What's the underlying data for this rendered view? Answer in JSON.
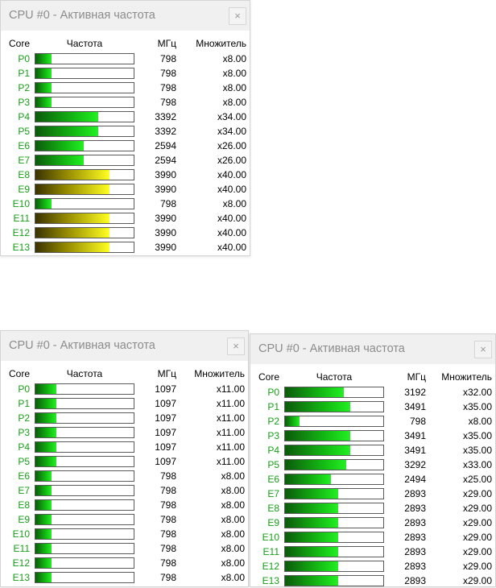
{
  "windows": [
    {
      "title": "CPU #0 - Активная частота",
      "close": "×",
      "headers": {
        "core": "Core",
        "freq": "Частота",
        "mhz": "МГц",
        "mult": "Множитель"
      },
      "rows": [
        {
          "core": "P0",
          "mhz": "798",
          "mult": "x8.00",
          "fill": 0.16,
          "color": "green"
        },
        {
          "core": "P1",
          "mhz": "798",
          "mult": "x8.00",
          "fill": 0.16,
          "color": "green"
        },
        {
          "core": "P2",
          "mhz": "798",
          "mult": "x8.00",
          "fill": 0.16,
          "color": "green"
        },
        {
          "core": "P3",
          "mhz": "798",
          "mult": "x8.00",
          "fill": 0.16,
          "color": "green"
        },
        {
          "core": "P4",
          "mhz": "3392",
          "mult": "x34.00",
          "fill": 0.64,
          "color": "green"
        },
        {
          "core": "P5",
          "mhz": "3392",
          "mult": "x34.00",
          "fill": 0.64,
          "color": "green"
        },
        {
          "core": "E6",
          "mhz": "2594",
          "mult": "x26.00",
          "fill": 0.49,
          "color": "green"
        },
        {
          "core": "E7",
          "mhz": "2594",
          "mult": "x26.00",
          "fill": 0.49,
          "color": "green"
        },
        {
          "core": "E8",
          "mhz": "3990",
          "mult": "x40.00",
          "fill": 0.75,
          "color": "yellow"
        },
        {
          "core": "E9",
          "mhz": "3990",
          "mult": "x40.00",
          "fill": 0.75,
          "color": "yellow"
        },
        {
          "core": "E10",
          "mhz": "798",
          "mult": "x8.00",
          "fill": 0.16,
          "color": "green"
        },
        {
          "core": "E11",
          "mhz": "3990",
          "mult": "x40.00",
          "fill": 0.75,
          "color": "yellow"
        },
        {
          "core": "E12",
          "mhz": "3990",
          "mult": "x40.00",
          "fill": 0.75,
          "color": "yellow"
        },
        {
          "core": "E13",
          "mhz": "3990",
          "mult": "x40.00",
          "fill": 0.75,
          "color": "yellow"
        }
      ]
    },
    {
      "title": "CPU #0 - Активная частота",
      "close": "×",
      "headers": {
        "core": "Core",
        "freq": "Частота",
        "mhz": "МГц",
        "mult": "Множитель"
      },
      "rows": [
        {
          "core": "P0",
          "mhz": "1097",
          "mult": "x11.00",
          "fill": 0.21,
          "color": "green"
        },
        {
          "core": "P1",
          "mhz": "1097",
          "mult": "x11.00",
          "fill": 0.21,
          "color": "green"
        },
        {
          "core": "P2",
          "mhz": "1097",
          "mult": "x11.00",
          "fill": 0.21,
          "color": "green"
        },
        {
          "core": "P3",
          "mhz": "1097",
          "mult": "x11.00",
          "fill": 0.21,
          "color": "green"
        },
        {
          "core": "P4",
          "mhz": "1097",
          "mult": "x11.00",
          "fill": 0.21,
          "color": "green"
        },
        {
          "core": "P5",
          "mhz": "1097",
          "mult": "x11.00",
          "fill": 0.21,
          "color": "green"
        },
        {
          "core": "E6",
          "mhz": "798",
          "mult": "x8.00",
          "fill": 0.16,
          "color": "green"
        },
        {
          "core": "E7",
          "mhz": "798",
          "mult": "x8.00",
          "fill": 0.16,
          "color": "green"
        },
        {
          "core": "E8",
          "mhz": "798",
          "mult": "x8.00",
          "fill": 0.16,
          "color": "green"
        },
        {
          "core": "E9",
          "mhz": "798",
          "mult": "x8.00",
          "fill": 0.16,
          "color": "green"
        },
        {
          "core": "E10",
          "mhz": "798",
          "mult": "x8.00",
          "fill": 0.16,
          "color": "green"
        },
        {
          "core": "E11",
          "mhz": "798",
          "mult": "x8.00",
          "fill": 0.16,
          "color": "green"
        },
        {
          "core": "E12",
          "mhz": "798",
          "mult": "x8.00",
          "fill": 0.16,
          "color": "green"
        },
        {
          "core": "E13",
          "mhz": "798",
          "mult": "x8.00",
          "fill": 0.16,
          "color": "green"
        }
      ]
    },
    {
      "title": "CPU #0 - Активная частота",
      "close": "×",
      "headers": {
        "core": "Core",
        "freq": "Частота",
        "mhz": "МГц",
        "mult": "Множитель"
      },
      "rows": [
        {
          "core": "P0",
          "mhz": "3192",
          "mult": "x32.00",
          "fill": 0.6,
          "color": "green"
        },
        {
          "core": "P1",
          "mhz": "3491",
          "mult": "x35.00",
          "fill": 0.66,
          "color": "green"
        },
        {
          "core": "P2",
          "mhz": "798",
          "mult": "x8.00",
          "fill": 0.15,
          "color": "green"
        },
        {
          "core": "P3",
          "mhz": "3491",
          "mult": "x35.00",
          "fill": 0.66,
          "color": "green"
        },
        {
          "core": "P4",
          "mhz": "3491",
          "mult": "x35.00",
          "fill": 0.66,
          "color": "green"
        },
        {
          "core": "P5",
          "mhz": "3292",
          "mult": "x33.00",
          "fill": 0.62,
          "color": "green"
        },
        {
          "core": "E6",
          "mhz": "2494",
          "mult": "x25.00",
          "fill": 0.47,
          "color": "green"
        },
        {
          "core": "E7",
          "mhz": "2893",
          "mult": "x29.00",
          "fill": 0.54,
          "color": "green"
        },
        {
          "core": "E8",
          "mhz": "2893",
          "mult": "x29.00",
          "fill": 0.54,
          "color": "green"
        },
        {
          "core": "E9",
          "mhz": "2893",
          "mult": "x29.00",
          "fill": 0.54,
          "color": "green"
        },
        {
          "core": "E10",
          "mhz": "2893",
          "mult": "x29.00",
          "fill": 0.54,
          "color": "green"
        },
        {
          "core": "E11",
          "mhz": "2893",
          "mult": "x29.00",
          "fill": 0.54,
          "color": "green"
        },
        {
          "core": "E12",
          "mhz": "2893",
          "mult": "x29.00",
          "fill": 0.54,
          "color": "green"
        },
        {
          "core": "E13",
          "mhz": "2893",
          "mult": "x29.00",
          "fill": 0.54,
          "color": "green"
        }
      ]
    }
  ]
}
